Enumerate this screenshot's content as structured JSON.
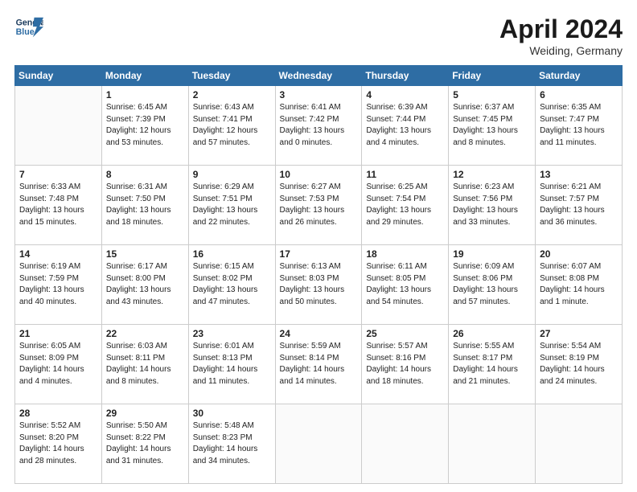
{
  "header": {
    "logo_line1": "General",
    "logo_line2": "Blue",
    "month": "April 2024",
    "location": "Weiding, Germany"
  },
  "days_of_week": [
    "Sunday",
    "Monday",
    "Tuesday",
    "Wednesday",
    "Thursday",
    "Friday",
    "Saturday"
  ],
  "weeks": [
    [
      {
        "num": "",
        "info": ""
      },
      {
        "num": "1",
        "info": "Sunrise: 6:45 AM\nSunset: 7:39 PM\nDaylight: 12 hours\nand 53 minutes."
      },
      {
        "num": "2",
        "info": "Sunrise: 6:43 AM\nSunset: 7:41 PM\nDaylight: 12 hours\nand 57 minutes."
      },
      {
        "num": "3",
        "info": "Sunrise: 6:41 AM\nSunset: 7:42 PM\nDaylight: 13 hours\nand 0 minutes."
      },
      {
        "num": "4",
        "info": "Sunrise: 6:39 AM\nSunset: 7:44 PM\nDaylight: 13 hours\nand 4 minutes."
      },
      {
        "num": "5",
        "info": "Sunrise: 6:37 AM\nSunset: 7:45 PM\nDaylight: 13 hours\nand 8 minutes."
      },
      {
        "num": "6",
        "info": "Sunrise: 6:35 AM\nSunset: 7:47 PM\nDaylight: 13 hours\nand 11 minutes."
      }
    ],
    [
      {
        "num": "7",
        "info": "Sunrise: 6:33 AM\nSunset: 7:48 PM\nDaylight: 13 hours\nand 15 minutes."
      },
      {
        "num": "8",
        "info": "Sunrise: 6:31 AM\nSunset: 7:50 PM\nDaylight: 13 hours\nand 18 minutes."
      },
      {
        "num": "9",
        "info": "Sunrise: 6:29 AM\nSunset: 7:51 PM\nDaylight: 13 hours\nand 22 minutes."
      },
      {
        "num": "10",
        "info": "Sunrise: 6:27 AM\nSunset: 7:53 PM\nDaylight: 13 hours\nand 26 minutes."
      },
      {
        "num": "11",
        "info": "Sunrise: 6:25 AM\nSunset: 7:54 PM\nDaylight: 13 hours\nand 29 minutes."
      },
      {
        "num": "12",
        "info": "Sunrise: 6:23 AM\nSunset: 7:56 PM\nDaylight: 13 hours\nand 33 minutes."
      },
      {
        "num": "13",
        "info": "Sunrise: 6:21 AM\nSunset: 7:57 PM\nDaylight: 13 hours\nand 36 minutes."
      }
    ],
    [
      {
        "num": "14",
        "info": "Sunrise: 6:19 AM\nSunset: 7:59 PM\nDaylight: 13 hours\nand 40 minutes."
      },
      {
        "num": "15",
        "info": "Sunrise: 6:17 AM\nSunset: 8:00 PM\nDaylight: 13 hours\nand 43 minutes."
      },
      {
        "num": "16",
        "info": "Sunrise: 6:15 AM\nSunset: 8:02 PM\nDaylight: 13 hours\nand 47 minutes."
      },
      {
        "num": "17",
        "info": "Sunrise: 6:13 AM\nSunset: 8:03 PM\nDaylight: 13 hours\nand 50 minutes."
      },
      {
        "num": "18",
        "info": "Sunrise: 6:11 AM\nSunset: 8:05 PM\nDaylight: 13 hours\nand 54 minutes."
      },
      {
        "num": "19",
        "info": "Sunrise: 6:09 AM\nSunset: 8:06 PM\nDaylight: 13 hours\nand 57 minutes."
      },
      {
        "num": "20",
        "info": "Sunrise: 6:07 AM\nSunset: 8:08 PM\nDaylight: 14 hours\nand 1 minute."
      }
    ],
    [
      {
        "num": "21",
        "info": "Sunrise: 6:05 AM\nSunset: 8:09 PM\nDaylight: 14 hours\nand 4 minutes."
      },
      {
        "num": "22",
        "info": "Sunrise: 6:03 AM\nSunset: 8:11 PM\nDaylight: 14 hours\nand 8 minutes."
      },
      {
        "num": "23",
        "info": "Sunrise: 6:01 AM\nSunset: 8:13 PM\nDaylight: 14 hours\nand 11 minutes."
      },
      {
        "num": "24",
        "info": "Sunrise: 5:59 AM\nSunset: 8:14 PM\nDaylight: 14 hours\nand 14 minutes."
      },
      {
        "num": "25",
        "info": "Sunrise: 5:57 AM\nSunset: 8:16 PM\nDaylight: 14 hours\nand 18 minutes."
      },
      {
        "num": "26",
        "info": "Sunrise: 5:55 AM\nSunset: 8:17 PM\nDaylight: 14 hours\nand 21 minutes."
      },
      {
        "num": "27",
        "info": "Sunrise: 5:54 AM\nSunset: 8:19 PM\nDaylight: 14 hours\nand 24 minutes."
      }
    ],
    [
      {
        "num": "28",
        "info": "Sunrise: 5:52 AM\nSunset: 8:20 PM\nDaylight: 14 hours\nand 28 minutes."
      },
      {
        "num": "29",
        "info": "Sunrise: 5:50 AM\nSunset: 8:22 PM\nDaylight: 14 hours\nand 31 minutes."
      },
      {
        "num": "30",
        "info": "Sunrise: 5:48 AM\nSunset: 8:23 PM\nDaylight: 14 hours\nand 34 minutes."
      },
      {
        "num": "",
        "info": ""
      },
      {
        "num": "",
        "info": ""
      },
      {
        "num": "",
        "info": ""
      },
      {
        "num": "",
        "info": ""
      }
    ]
  ]
}
